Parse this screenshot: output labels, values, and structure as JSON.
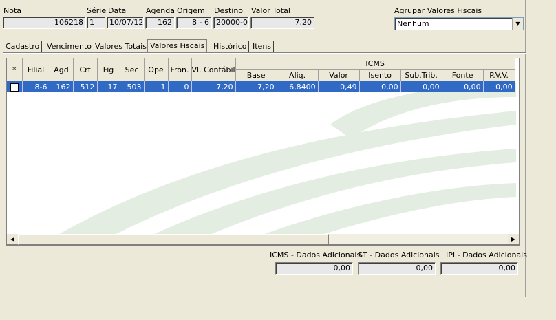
{
  "header": {
    "nota_label": "Nota",
    "nota_value": "106218",
    "serie_label": "Série",
    "serie_value": "1",
    "data_label": "Data",
    "data_value": "10/07/12",
    "agenda_label": "Agenda",
    "agenda_value": "162",
    "origem_label": "Origem",
    "origem_value": "8 - 6",
    "destino_label": "Destino",
    "destino_value": "20000-0",
    "valor_total_label": "Valor Total",
    "valor_total_value": "7,20",
    "agrupar_label": "Agrupar Valores Fiscais",
    "agrupar_value": "Nenhum"
  },
  "tabs": [
    {
      "label": "Cadastro"
    },
    {
      "label": "Vencimento"
    },
    {
      "label": "Valores Totais"
    },
    {
      "label": "Valores Fiscais"
    },
    {
      "label": "Histórico"
    },
    {
      "label": "Itens"
    }
  ],
  "active_tab": "Valores Fiscais",
  "grid": {
    "group_header": "ICMS",
    "columns": [
      "*",
      "Filial",
      "Agd",
      "Crf",
      "Fig",
      "Sec",
      "Ope",
      "Fron.",
      "Vl. Contábil",
      "Base",
      "Aliq.",
      "Valor",
      "Isento",
      "Sub.Trib.",
      "Fonte",
      "P.V.V."
    ],
    "rows": [
      [
        "",
        "8-6",
        "162",
        "512",
        "17",
        "503",
        "1",
        "0",
        "7,20",
        "7,20",
        "6,8400",
        "0,49",
        "0,00",
        "0,00",
        "0,00",
        "0,00"
      ]
    ]
  },
  "footer": {
    "icms_label": "ICMS - Dados Adicionais",
    "icms_value": "0,00",
    "st_label": "ST - Dados Adicionais",
    "st_value": "0,00",
    "ipi_label": "IPI - Dados Adicionais",
    "ipi_value": "0,00"
  },
  "colors": {
    "selection": "#316AC5",
    "background": "#ECE9D8",
    "watermark": "#E4EDE2"
  }
}
